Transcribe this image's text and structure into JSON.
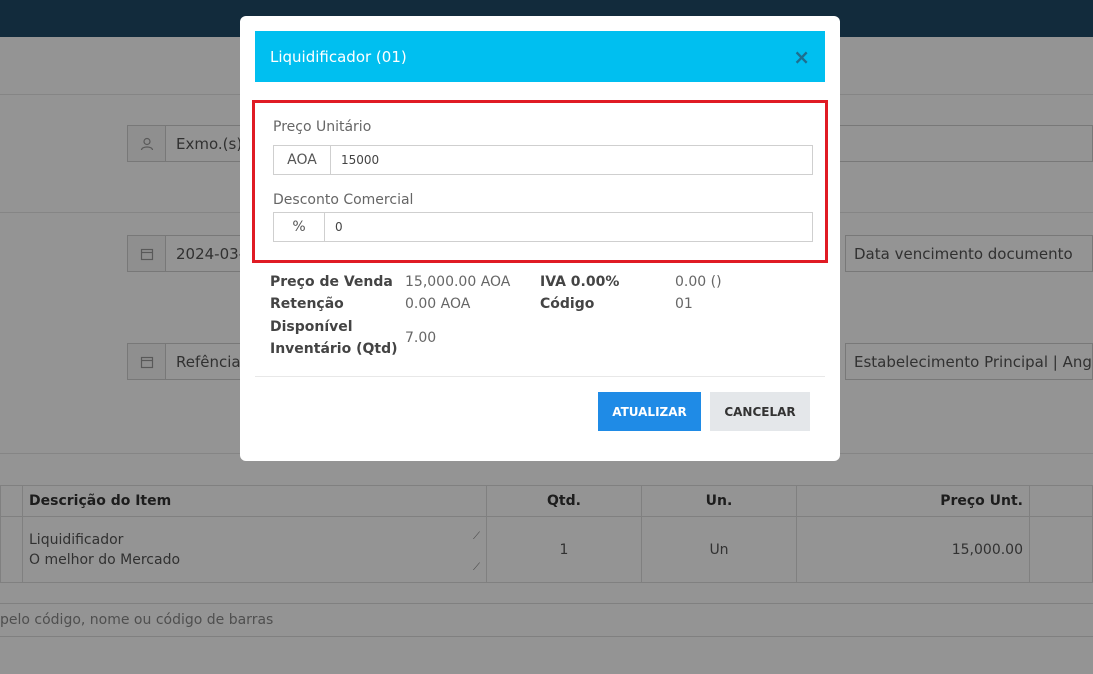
{
  "background": {
    "client_field": "Exmo.(s)",
    "date_field": "2024-03-",
    "due_date_placeholder": "Data vencimento documento",
    "reference_field": "Refência",
    "establishment_field": "Estabelecimento Principal | Ang",
    "table": {
      "headers": {
        "description": "Descrição do Item",
        "qty": "Qtd.",
        "unit": "Un.",
        "unit_price": "Preço Unt."
      },
      "row": {
        "name": "Liquidificador",
        "subtitle": "O melhor do Mercado",
        "qty": "1",
        "unit": "Un",
        "unit_price": "15,000.00"
      }
    },
    "search_placeholder": "pelo código, nome ou código de barras"
  },
  "modal": {
    "title": "Liquidificador (01)",
    "close_symbol": "×",
    "unit_price_label": "Preço Unitário",
    "currency_addon": "AOA",
    "unit_price_value": "15000",
    "discount_label": "Desconto Comercial",
    "discount_addon": "%",
    "discount_value": "0",
    "details": {
      "sale_price_label": "Preço de Venda",
      "sale_price_value": "15,000.00 AOA",
      "vat_label": "IVA 0.00%",
      "vat_value": "0.00 ()",
      "retention_label": "Retenção",
      "retention_value": "0.00 AOA",
      "code_label": "Código",
      "code_value": "01",
      "available_label_line1": "Disponível",
      "available_label_line2": "Inventário (Qtd)",
      "available_value": "7.00"
    },
    "update_button": "ATUALIZAR",
    "cancel_button": "CANCELAR"
  },
  "colors": {
    "modal_header": "#00bff0",
    "highlight_border": "#e01b24",
    "primary_button": "#1f8be6",
    "topbar": "#1f4a68"
  },
  "icons": {
    "user": "user-icon",
    "calendar": "calendar-icon",
    "close": "close-icon"
  }
}
